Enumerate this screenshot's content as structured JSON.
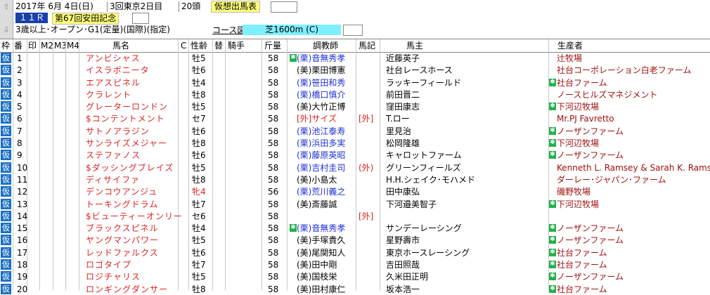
{
  "race": {
    "date": "2017年 6月 4日(日)",
    "meeting": "3回東京2日目",
    "runners": "20頭",
    "card_label": "仮想出馬表",
    "race_no": "１１Ｒ",
    "race_name": "第67回安田記念",
    "conditions": "3歳以上･オープン･G1(定量)(国際)(指定)",
    "course_label": "コース図",
    "course": "芝1600m (C)"
  },
  "columns": [
    "枠",
    "番",
    "印",
    "M2",
    "M3",
    "M4",
    "馬名",
    "C",
    "性齢",
    "替",
    "騎手",
    "斤量",
    "",
    "調教師",
    "馬記",
    "馬主",
    "生産者"
  ],
  "waku_label": "仮",
  "horses": [
    {
      "no": "1",
      "name": "アンビシャス",
      "sex": "牡5",
      "wt": "58",
      "mark": "✱",
      "trainer": "(栗)音無秀孝",
      "tclass": "blue",
      "note": "",
      "owner": "近藤英子",
      "breeder": "辻牧場",
      "bmark": ""
    },
    {
      "no": "2",
      "name": "イスラボニータ",
      "sex": "牡6",
      "wt": "58",
      "mark": "",
      "trainer": "(美)栗田博憲",
      "tclass": "",
      "note": "",
      "owner": "社台レースホース",
      "breeder": "社台コーポレーション白老ファーム",
      "bmark": ""
    },
    {
      "no": "3",
      "name": "エアスピネル",
      "sex": "牡4",
      "wt": "58",
      "mark": "",
      "trainer": "(栗)笹田和秀",
      "tclass": "blue",
      "note": "",
      "owner": "ラッキーフィールド",
      "breeder": "社台ファーム",
      "bmark": "✱"
    },
    {
      "no": "4",
      "name": "クラレント",
      "sex": "牡8",
      "wt": "58",
      "mark": "",
      "trainer": "(栗)橋口慎介",
      "tclass": "blue",
      "note": "",
      "owner": "前田晋二",
      "breeder": "ノースヒルズマネジメント",
      "bmark": ""
    },
    {
      "no": "5",
      "name": "グレーターロンドン",
      "sex": "牡5",
      "wt": "58",
      "mark": "",
      "trainer": "(美)大竹正博",
      "tclass": "",
      "note": "",
      "owner": "窪田康志",
      "breeder": "下河辺牧場",
      "bmark": "✱"
    },
    {
      "no": "6",
      "name": "$コンテントメント",
      "sex": "セ7",
      "wt": "58",
      "mark": "",
      "trainer": "[外]サイズ",
      "tclass": "red",
      "note": "[外]",
      "owner": "T.ロー",
      "breeder": "Mr.PJ Favretto",
      "bmark": ""
    },
    {
      "no": "7",
      "name": "サトノアラジン",
      "sex": "牡6",
      "wt": "58",
      "mark": "",
      "trainer": "(栗)池江泰寿",
      "tclass": "blue",
      "note": "",
      "owner": "里見治",
      "breeder": "ノーザンファーム",
      "bmark": "✱"
    },
    {
      "no": "8",
      "name": "サンライズメジャー",
      "sex": "牡8",
      "wt": "58",
      "mark": "",
      "trainer": "(栗)浜田多実",
      "tclass": "blue",
      "note": "",
      "owner": "松岡隆雄",
      "breeder": "下河辺牧場",
      "bmark": "✱"
    },
    {
      "no": "9",
      "name": "ステファノス",
      "sex": "牡6",
      "wt": "58",
      "mark": "",
      "trainer": "(栗)藤原英昭",
      "tclass": "blue",
      "note": "",
      "owner": "キャロットファーム",
      "breeder": "ノーザンファーム",
      "bmark": "✱"
    },
    {
      "no": "10",
      "name": "$ダッシングブレイズ",
      "sex": "牡5",
      "wt": "58",
      "mark": "",
      "trainer": "(栗)吉村圭司",
      "tclass": "blue",
      "note": "(外)",
      "owner": "グリーンフィールズ",
      "breeder": "Kenneth L. Ramsey & Sarah K. Ramsey",
      "bmark": ""
    },
    {
      "no": "11",
      "name": "ディサイファ",
      "sex": "牡8",
      "wt": "58",
      "mark": "",
      "trainer": "(美)小島太",
      "tclass": "",
      "note": "",
      "owner": "H.H.シェイク･モハメド",
      "breeder": "ダーレー･ジャパン･ファーム",
      "bmark": ""
    },
    {
      "no": "12",
      "name": "デンコウアンジュ",
      "sex": "牝4",
      "wt": "56",
      "mark": "",
      "trainer": "(栗)荒川義之",
      "tclass": "blue",
      "note": "",
      "owner": "田中康弘",
      "breeder": "磯野牧場",
      "bmark": ""
    },
    {
      "no": "13",
      "name": "トーキングドラム",
      "sex": "牡7",
      "wt": "58",
      "mark": "",
      "trainer": "(美)斎藤誠",
      "tclass": "",
      "note": "",
      "owner": "下河邉美智子",
      "breeder": "下河辺牧場",
      "bmark": "✱"
    },
    {
      "no": "14",
      "name": "$ビューティーオンリー",
      "sex": "セ6",
      "wt": "58",
      "mark": "",
      "trainer": "",
      "tclass": "",
      "note": "[外]",
      "owner": "",
      "breeder": "",
      "bmark": ""
    },
    {
      "no": "15",
      "name": "ブラックスピネル",
      "sex": "牡4",
      "wt": "58",
      "mark": "✱",
      "trainer": "(栗)音無秀孝",
      "tclass": "blue",
      "note": "",
      "owner": "サンデーレーシング",
      "breeder": "ノーザンファーム",
      "bmark": "✱"
    },
    {
      "no": "16",
      "name": "ヤングマンパワー",
      "sex": "牡5",
      "wt": "58",
      "mark": "",
      "trainer": "(美)手塚貴久",
      "tclass": "",
      "note": "",
      "owner": "星野壽市",
      "breeder": "ノーザンファーム",
      "bmark": "✱"
    },
    {
      "no": "17",
      "name": "レッドファルクス",
      "sex": "牡6",
      "wt": "58",
      "mark": "",
      "trainer": "(美)尾関知人",
      "tclass": "",
      "note": "",
      "owner": "東京ホースレーシング",
      "breeder": "社台ファーム",
      "bmark": "✱"
    },
    {
      "no": "18",
      "name": "ロゴタイプ",
      "sex": "牡7",
      "wt": "58",
      "mark": "",
      "trainer": "(美)田中剛",
      "tclass": "",
      "note": "",
      "owner": "吉田照哉",
      "breeder": "社台ファーム",
      "bmark": "✱"
    },
    {
      "no": "19",
      "name": "ロジチャリス",
      "sex": "牡5",
      "wt": "58",
      "mark": "",
      "trainer": "(美)国枝栄",
      "tclass": "",
      "note": "",
      "owner": "久米田正明",
      "breeder": "ノーザンファーム",
      "bmark": "✱"
    },
    {
      "no": "20",
      "name": "ロンギングダンサー",
      "sex": "牡8",
      "wt": "58",
      "mark": "",
      "trainer": "(美)田村康仁",
      "tclass": "",
      "note": "",
      "owner": "坂本浩一",
      "breeder": "社台ファーム",
      "bmark": "✱"
    }
  ]
}
